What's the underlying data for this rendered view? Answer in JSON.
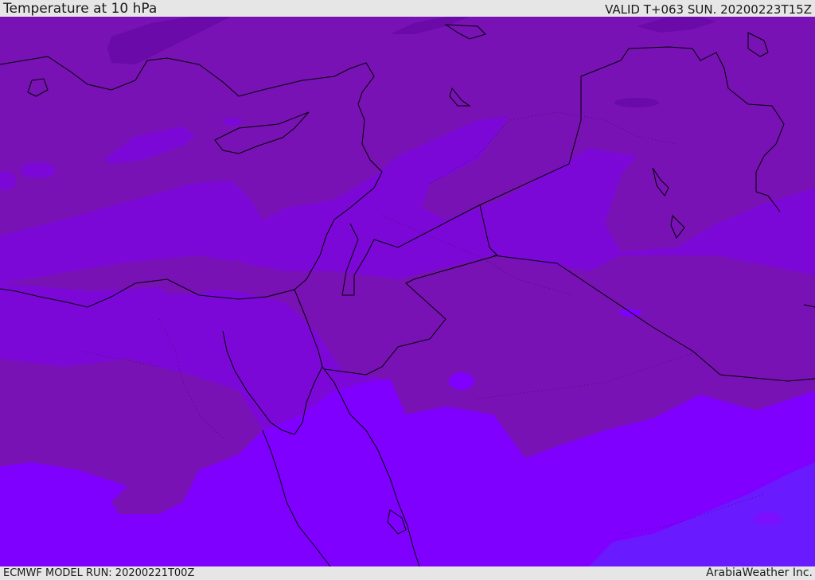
{
  "header": {
    "title": "Temperature at 10 hPa",
    "valid": "VALID T+063 SUN. 20200223T15Z"
  },
  "footer": {
    "model_run": "ECMWF MODEL RUN: 20200221T00Z",
    "credit": "ArabiaWeather Inc."
  },
  "map": {
    "colors": {
      "darkest_band": "#6a0aa8",
      "dark_band": "#7812b4",
      "mid_band": "#7c08d8",
      "light_band": "#7f00ff",
      "lightest_band": "#6a1aff",
      "coastline": "#000000"
    }
  }
}
